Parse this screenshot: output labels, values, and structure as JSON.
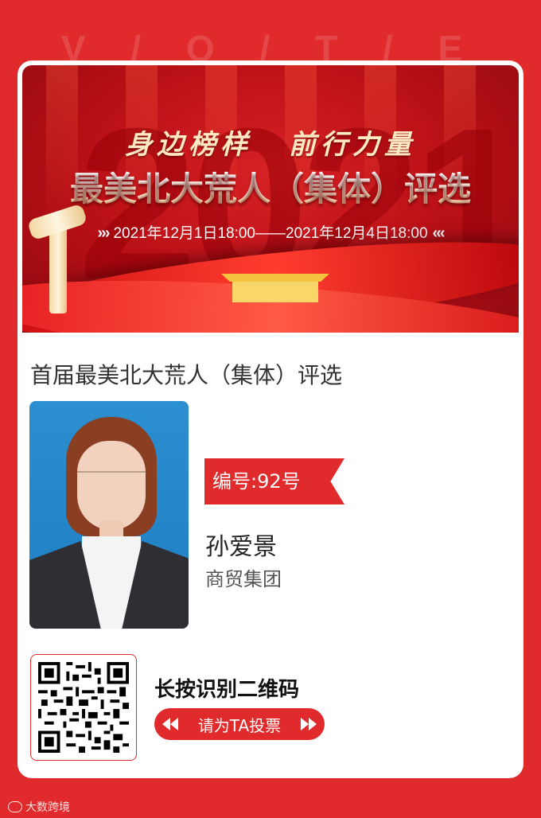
{
  "background_watermark": "V / O / T / E",
  "banner": {
    "year_bg": "2021",
    "slogan_left": "身边榜样",
    "slogan_right": "前行力量",
    "title": "最美北大荒人（集体）评选",
    "date_range": "2021年12月1日18:00——2021年12月4日18:00",
    "chevrons_left": "›››",
    "chevrons_right": "‹‹‹"
  },
  "page_title": "首届最美北大荒人（集体）评选",
  "candidate": {
    "number_label": "编号:92号",
    "name": "孙爱景",
    "organization": "商贸集团"
  },
  "qr": {
    "scan_prompt": "长按识别二维码",
    "vote_button": "请为TA投票"
  },
  "footer_watermark": "大数跨境",
  "colors": {
    "primary_red": "#e12a2b",
    "card_bg": "#ffffff"
  }
}
